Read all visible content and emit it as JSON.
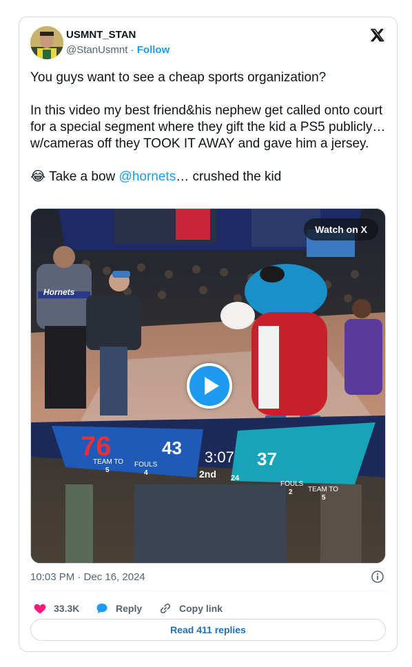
{
  "author": {
    "name": "USMNT_STAN",
    "handle": "@StanUsmnt",
    "separator": " · ",
    "follow_label": "Follow"
  },
  "tweet": {
    "line1": "You guys want to see a cheap sports organization?",
    "line2": "In this video my best friend&his nephew get called onto court for a special segment where they gift the kid a PS5 publicly… w/cameras off they TOOK IT AWAY and gave him a jersey.",
    "emoji": "😂",
    "line3_prefix": " Take a bow ",
    "mention": "@hornets",
    "line3_suffix": "… crushed the kid"
  },
  "media": {
    "watch_label": "Watch on X",
    "scoreboard": {
      "home_score": "43",
      "clock": "3:07",
      "away_score": "37",
      "period": "2nd",
      "shot_clock": "24",
      "home_logo": "76",
      "team_to_label": "TEAM TO",
      "fouls_label": "FOULS",
      "home_to": "5",
      "home_fouls": "4",
      "away_fouls": "2",
      "away_to": "5"
    },
    "jersey_text": "Hornets"
  },
  "timestamp": "10:03 PM · Dec 16, 2024",
  "actions": {
    "likes": "33.3K",
    "reply_label": "Reply",
    "copy_label": "Copy link"
  },
  "read_replies_label": "Read 411 replies",
  "colors": {
    "accent": "#1d9bf0",
    "like": "#f91880",
    "text": "#0f1419",
    "muted": "#536471"
  }
}
